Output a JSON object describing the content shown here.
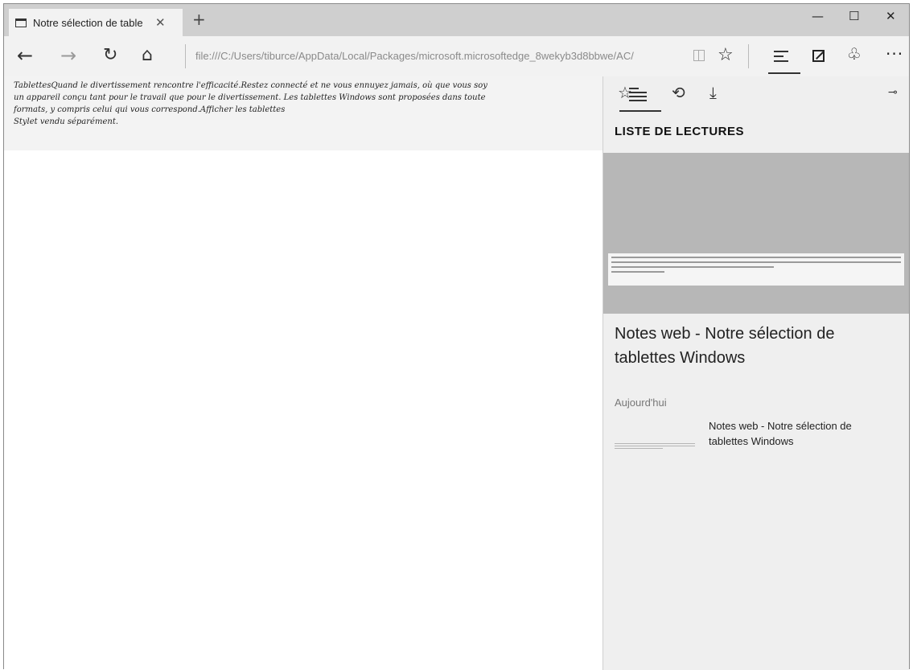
{
  "tab": {
    "title": "Notre sélection de table",
    "close": "✕",
    "new_tab": "+"
  },
  "window_controls": {
    "minimize": "—",
    "maximize": "☐",
    "close": "✕"
  },
  "navbar": {
    "back": "←",
    "forward": "→",
    "refresh": "↻",
    "home": "⌂",
    "address": "file:///C:/Users/tiburce/AppData/Local/Packages/microsoft.microsoftedge_8wekyb3d8bbwe/AC/",
    "favorite": "☆",
    "share": "♧",
    "more": "···"
  },
  "page": {
    "lines": [
      "TablettesQuand le divertissement rencontre l'efficacité.Restez connecté et ne vous ennuyez jamais, où que vous soy",
      "un appareil conçu tant pour le travail que pour le divertissement. Les tablettes Windows sont proposées dans toute",
      "formats, y compris celui qui vous correspond.Afficher les tablettes",
      "Stylet vendu séparément."
    ]
  },
  "hub": {
    "tabs": {
      "favorites": "☆",
      "history": "⟲",
      "downloads": "⤓"
    },
    "pin": "⊸",
    "heading": "LISTE DE LECTURES",
    "item_title": "Notes web - Notre sélection de tablettes Windows",
    "section_label": "Aujourd'hui",
    "list_item_title": "Notes web - Notre sélection de tablettes Windows"
  }
}
